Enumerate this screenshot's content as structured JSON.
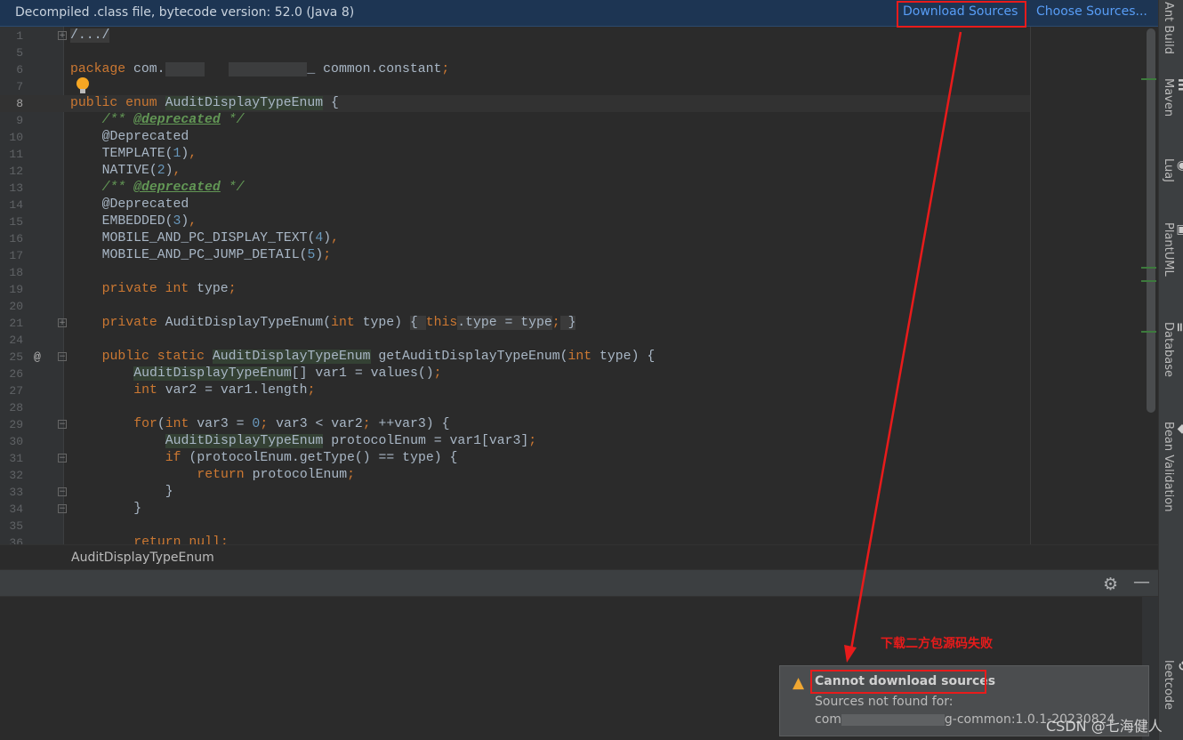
{
  "banner": {
    "message": "Decompiled .class file, bytecode version: 52.0 (Java 8)",
    "download_sources": "Download Sources",
    "choose_sources": "Choose Sources..."
  },
  "editor": {
    "lines": [
      {
        "n": "1",
        "fold": "+",
        "t": [
          [
            "/.../",
            "fold"
          ]
        ]
      },
      {
        "n": "5",
        "t": []
      },
      {
        "n": "6",
        "t": [
          [
            "package ",
            "kw"
          ],
          [
            "com.",
            "tx"
          ],
          [
            "█████",
            "blur"
          ],
          [
            "   ",
            "tx"
          ],
          [
            "██████████",
            "blur"
          ],
          [
            "_ common.constant",
            "tx"
          ],
          [
            ";",
            "kw"
          ]
        ]
      },
      {
        "n": "7",
        "t": []
      },
      {
        "n": "8",
        "cur": true,
        "t": [
          [
            "public enum ",
            "kw"
          ],
          [
            "AuditDisplayTypeEnum",
            "hl"
          ],
          [
            " {",
            "tx"
          ]
        ]
      },
      {
        "n": "9",
        "i": 1,
        "t": [
          [
            "/** ",
            "doc"
          ],
          [
            "@deprecated",
            "tag"
          ],
          [
            " */",
            "doc"
          ]
        ]
      },
      {
        "n": "10",
        "i": 1,
        "t": [
          [
            "@Deprecated",
            "tx"
          ]
        ]
      },
      {
        "n": "11",
        "i": 1,
        "t": [
          [
            "TEMPLATE(",
            "tx"
          ],
          [
            "1",
            "num"
          ],
          [
            ")",
            "tx"
          ],
          [
            ",",
            "kw"
          ]
        ]
      },
      {
        "n": "12",
        "i": 1,
        "t": [
          [
            "NATIVE(",
            "tx"
          ],
          [
            "2",
            "num"
          ],
          [
            ")",
            "tx"
          ],
          [
            ",",
            "kw"
          ]
        ]
      },
      {
        "n": "13",
        "i": 1,
        "t": [
          [
            "/** ",
            "doc"
          ],
          [
            "@deprecated",
            "tag"
          ],
          [
            " */",
            "doc"
          ]
        ]
      },
      {
        "n": "14",
        "i": 1,
        "t": [
          [
            "@Deprecated",
            "tx"
          ]
        ]
      },
      {
        "n": "15",
        "i": 1,
        "t": [
          [
            "EMBEDDED(",
            "tx"
          ],
          [
            "3",
            "num"
          ],
          [
            ")",
            "tx"
          ],
          [
            ",",
            "kw"
          ]
        ]
      },
      {
        "n": "16",
        "i": 1,
        "t": [
          [
            "MOBILE_AND_PC_DISPLAY_TEXT(",
            "tx"
          ],
          [
            "4",
            "num"
          ],
          [
            ")",
            "tx"
          ],
          [
            ",",
            "kw"
          ]
        ]
      },
      {
        "n": "17",
        "i": 1,
        "t": [
          [
            "MOBILE_AND_PC_JUMP_DETAIL(",
            "tx"
          ],
          [
            "5",
            "num"
          ],
          [
            ")",
            "tx"
          ],
          [
            ";",
            "kw"
          ]
        ]
      },
      {
        "n": "18",
        "t": []
      },
      {
        "n": "19",
        "i": 1,
        "t": [
          [
            "private int ",
            "kw"
          ],
          [
            "type",
            "tx"
          ],
          [
            ";",
            "kw"
          ]
        ]
      },
      {
        "n": "20",
        "t": []
      },
      {
        "n": "21",
        "i": 1,
        "fold": "+",
        "t": [
          [
            "private ",
            "kw"
          ],
          [
            "AuditDisplayTypeEnum(",
            "tx"
          ],
          [
            "int ",
            "kw"
          ],
          [
            "type) ",
            "tx"
          ],
          [
            "{ ",
            "fold"
          ],
          [
            "this",
            "kw"
          ],
          [
            ".type = type",
            "fold"
          ],
          [
            ";",
            "kw"
          ],
          [
            " }",
            "fold"
          ]
        ]
      },
      {
        "n": "24",
        "t": []
      },
      {
        "n": "25",
        "i": 1,
        "fold": "-",
        "at": "@",
        "t": [
          [
            "public static ",
            "kw"
          ],
          [
            "AuditDisplayTypeEnum",
            "hl"
          ],
          [
            " getAuditDisplayTypeEnum(",
            "tx"
          ],
          [
            "int ",
            "kw"
          ],
          [
            "type) {",
            "tx"
          ]
        ]
      },
      {
        "n": "26",
        "i": 2,
        "t": [
          [
            "AuditDisplayTypeEnum",
            "hl"
          ],
          [
            "[] var1 = values()",
            "tx"
          ],
          [
            ";",
            "kw"
          ]
        ]
      },
      {
        "n": "27",
        "i": 2,
        "t": [
          [
            "int ",
            "kw"
          ],
          [
            "var2 = var1.length",
            "tx"
          ],
          [
            ";",
            "kw"
          ]
        ]
      },
      {
        "n": "28",
        "t": []
      },
      {
        "n": "29",
        "i": 2,
        "fold": "-",
        "t": [
          [
            "for",
            "kw"
          ],
          [
            "(",
            "tx"
          ],
          [
            "int ",
            "kw"
          ],
          [
            "var3 = ",
            "tx"
          ],
          [
            "0",
            "num"
          ],
          [
            "; ",
            "kw"
          ],
          [
            "var3 < var2",
            "tx"
          ],
          [
            "; ",
            "kw"
          ],
          [
            "++var3) {",
            "tx"
          ]
        ]
      },
      {
        "n": "30",
        "i": 3,
        "t": [
          [
            "AuditDisplayTypeEnum",
            "hl"
          ],
          [
            " protocolEnum = var1[var3]",
            "tx"
          ],
          [
            ";",
            "kw"
          ]
        ]
      },
      {
        "n": "31",
        "i": 3,
        "fold": "-",
        "t": [
          [
            "if ",
            "kw"
          ],
          [
            "(protocolEnum.getType() == type) {",
            "tx"
          ]
        ]
      },
      {
        "n": "32",
        "i": 4,
        "t": [
          [
            "return ",
            "kw"
          ],
          [
            "protocolEnum",
            "tx"
          ],
          [
            ";",
            "kw"
          ]
        ]
      },
      {
        "n": "33",
        "i": 3,
        "fold": "-",
        "t": [
          [
            "}",
            "tx"
          ]
        ]
      },
      {
        "n": "34",
        "i": 2,
        "fold": "-",
        "t": [
          [
            "}",
            "tx"
          ]
        ]
      },
      {
        "n": "35",
        "t": []
      },
      {
        "n": "36",
        "i": 2,
        "t": [
          [
            "return null",
            "kw"
          ],
          [
            ";",
            "kw"
          ]
        ]
      }
    ]
  },
  "breadcrumb": "AuditDisplayTypeEnum",
  "toolwindow": {
    "gear_icon": "gear-icon",
    "minimize_icon": "minimize-icon"
  },
  "sidebar": [
    {
      "label": "Ant Build",
      "icon": ""
    },
    {
      "label": "Maven",
      "icon": "m"
    },
    {
      "label": "LuaJ",
      "icon": "◉"
    },
    {
      "label": "PlantUML",
      "icon": "▣"
    },
    {
      "label": "Database",
      "icon": "≣"
    },
    {
      "label": "Bean Validation",
      "icon": "◆"
    },
    {
      "label": "leetcode",
      "icon": "⟲"
    }
  ],
  "notification": {
    "title": "Cannot download sources",
    "body1": "Sources not found for:",
    "body2_prefix": "com",
    "body2_suffix": "g-common:1.0.1-20230824",
    "icon": "warning-icon",
    "warning_color": "#f0a732"
  },
  "annotation": {
    "text": "下载二方包源码失败",
    "color": "#e81b1b"
  },
  "watermark": "CSDN @七海健人"
}
